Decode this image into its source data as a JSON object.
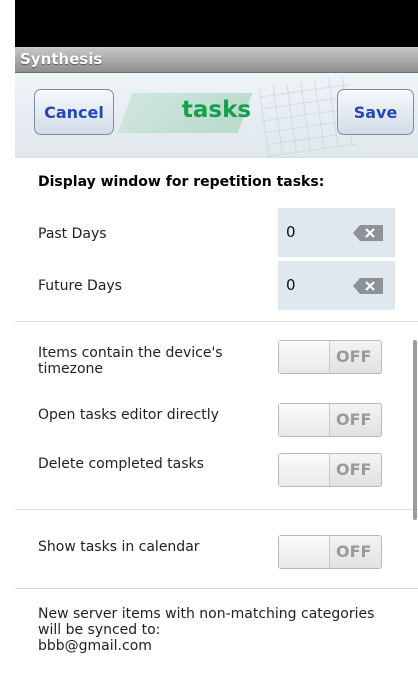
{
  "window": {
    "title": "Synthesis"
  },
  "header": {
    "title": "tasks",
    "cancel_label": "Cancel",
    "save_label": "Save"
  },
  "repetition": {
    "heading": "Display window for repetition tasks:",
    "past_days_label": "Past Days",
    "past_days_value": "0",
    "future_days_label": "Future Days",
    "future_days_value": "0"
  },
  "settings": {
    "timezone_label": "Items contain the device's timezone",
    "timezone_state": "OFF",
    "open_editor_label": "Open tasks editor directly",
    "open_editor_state": "OFF",
    "delete_completed_label": "Delete completed tasks",
    "delete_completed_state": "OFF",
    "show_calendar_label": "Show tasks in calendar",
    "show_calendar_state": "OFF"
  },
  "footer": {
    "text": "New server items with non-matching categories will be synced to:",
    "email": "bbb@gmail.com"
  },
  "colors": {
    "title_green": "#14a04c",
    "button_text_blue": "#2349b0"
  },
  "icons": {
    "clear": "backspace-clear-icon"
  }
}
